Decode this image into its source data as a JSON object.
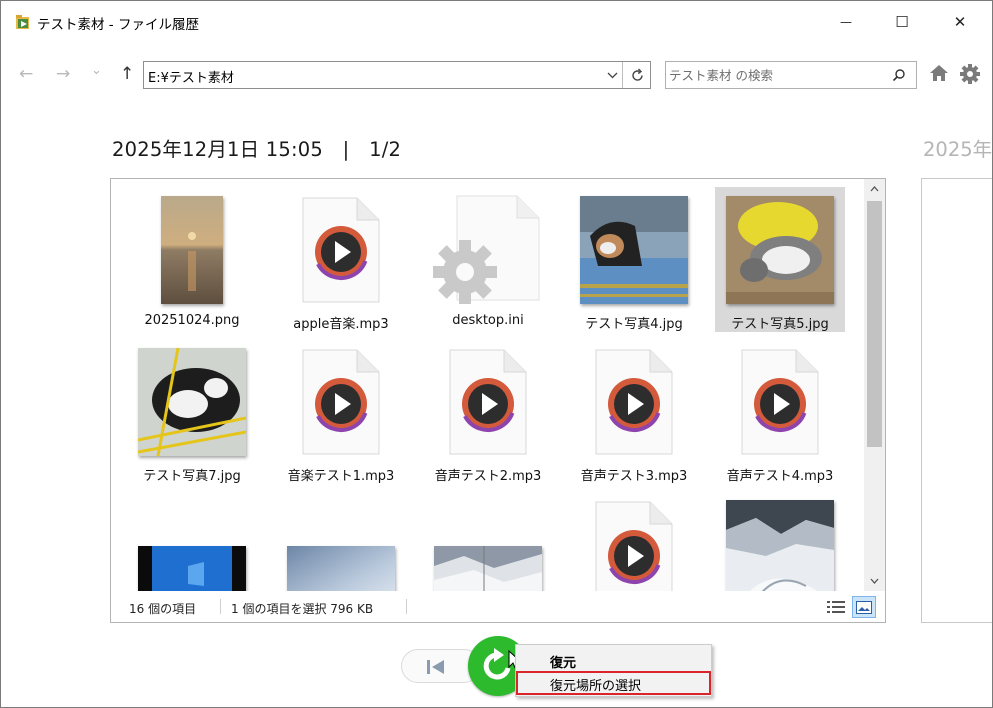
{
  "window": {
    "title": "テスト素材 - ファイル履歴",
    "minimize_glyph": "—",
    "maximize_glyph": "☐",
    "close_glyph": "✕"
  },
  "nav": {
    "back_glyph": "←",
    "forward_glyph": "→",
    "recent_glyph": "⌄",
    "up_glyph": "↑",
    "address": "E:¥テスト素材",
    "search_placeholder": "テスト素材 の検索"
  },
  "header": {
    "date_title": "2025年12月1日 15:05　|　1/2",
    "next_date": "2025年"
  },
  "files": [
    {
      "name": "20251024.png",
      "kind": "photo-sunset"
    },
    {
      "name": "apple音楽.mp3",
      "kind": "audio"
    },
    {
      "name": "desktop.ini",
      "kind": "settings"
    },
    {
      "name": "テスト写真4.jpg",
      "kind": "photo-dog"
    },
    {
      "name": "テスト写真5.jpg",
      "kind": "photo-cat-yellow",
      "selected": true
    },
    {
      "name": "テスト写真7.jpg",
      "kind": "photo-cat-bw"
    },
    {
      "name": "音楽テスト1.mp3",
      "kind": "audio"
    },
    {
      "name": "音声テスト2.mp3",
      "kind": "audio"
    },
    {
      "name": "音声テスト3.mp3",
      "kind": "audio"
    },
    {
      "name": "音声テスト4.mp3",
      "kind": "audio"
    },
    {
      "name": "",
      "kind": "photo-desktop"
    },
    {
      "name": "",
      "kind": "photo-sky"
    },
    {
      "name": "",
      "kind": "photo-snow"
    },
    {
      "name": "",
      "kind": "audio"
    },
    {
      "name": "",
      "kind": "photo-mountain"
    }
  ],
  "status": {
    "item_count": "16 個の項目",
    "selection": "1 個の項目を選択  796 KB"
  },
  "context_menu": {
    "restore": "復元",
    "restore_to": "復元場所の選択"
  },
  "colors": {
    "restore_green": "#2dbb2d",
    "menu_highlight_border": "#d9262b",
    "selected_item": "#d9d9d9"
  }
}
